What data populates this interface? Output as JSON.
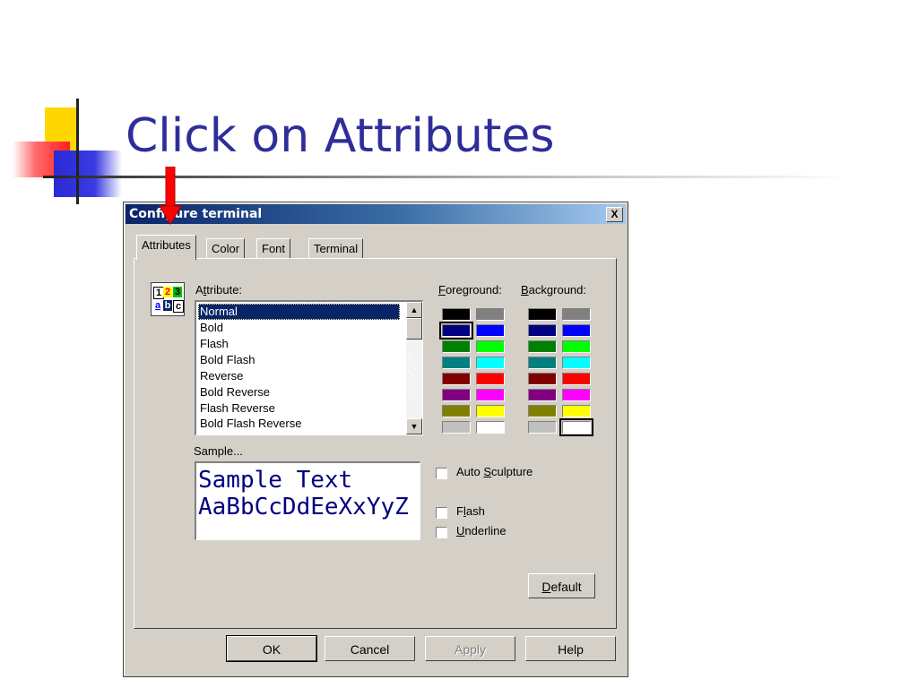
{
  "slide": {
    "title": "Click on Attributes"
  },
  "dialog": {
    "title": "Configure terminal",
    "close_label": "X",
    "tabs": [
      {
        "label": "Attributes",
        "active": true
      },
      {
        "label": "Color",
        "active": false
      },
      {
        "label": "Font",
        "active": false
      },
      {
        "label": "Terminal",
        "active": false
      }
    ],
    "attribute_icon": {
      "digits": [
        "1",
        "2",
        "3"
      ],
      "letters": [
        "a",
        "b",
        "c"
      ]
    },
    "attribute_label_pre": "A",
    "attribute_label_mn": "t",
    "attribute_label_post": "tribute:",
    "attributes": [
      "Normal",
      "Bold",
      "Flash",
      "Bold Flash",
      "Reverse",
      "Bold Reverse",
      "Flash Reverse",
      "Bold Flash Reverse"
    ],
    "selected_attribute": "Normal",
    "foreground_label_mn": "F",
    "foreground_label_post": "oreground:",
    "background_label_mn": "B",
    "background_label_post": "ackground:",
    "palette": [
      [
        "#000000",
        "#808080"
      ],
      [
        "#000080",
        "#0000ff"
      ],
      [
        "#008000",
        "#00ff00"
      ],
      [
        "#008080",
        "#00ffff"
      ],
      [
        "#800000",
        "#ff0000"
      ],
      [
        "#800080",
        "#ff00ff"
      ],
      [
        "#808000",
        "#ffff00"
      ],
      [
        "#c0c0c0",
        "#ffffff"
      ]
    ],
    "foreground_selected": "#000080",
    "background_selected": "#ffffff",
    "sample_label": "Sample...",
    "sample_lines": [
      "Sample Text",
      "AaBbCcDdEeXxYyZ"
    ],
    "sample_color": "#000080",
    "options": {
      "auto_sculpture": {
        "pre": "Auto ",
        "mn": "S",
        "post": "culpture",
        "checked": false
      },
      "flash": {
        "pre": "F",
        "mn": "l",
        "post": "ash",
        "checked": false
      },
      "underline": {
        "pre": "",
        "mn": "U",
        "post": "nderline",
        "checked": false
      }
    },
    "default_button": {
      "mn": "D",
      "post": "efault"
    },
    "buttons": {
      "ok": "OK",
      "cancel": "Cancel",
      "apply": "Apply",
      "help": "Help"
    }
  },
  "colors": {
    "title_text": "#2e2e9a",
    "titlebar_start": "#0a246a",
    "dialog_face": "#d4d0c8",
    "arrow": "#ff0000"
  }
}
